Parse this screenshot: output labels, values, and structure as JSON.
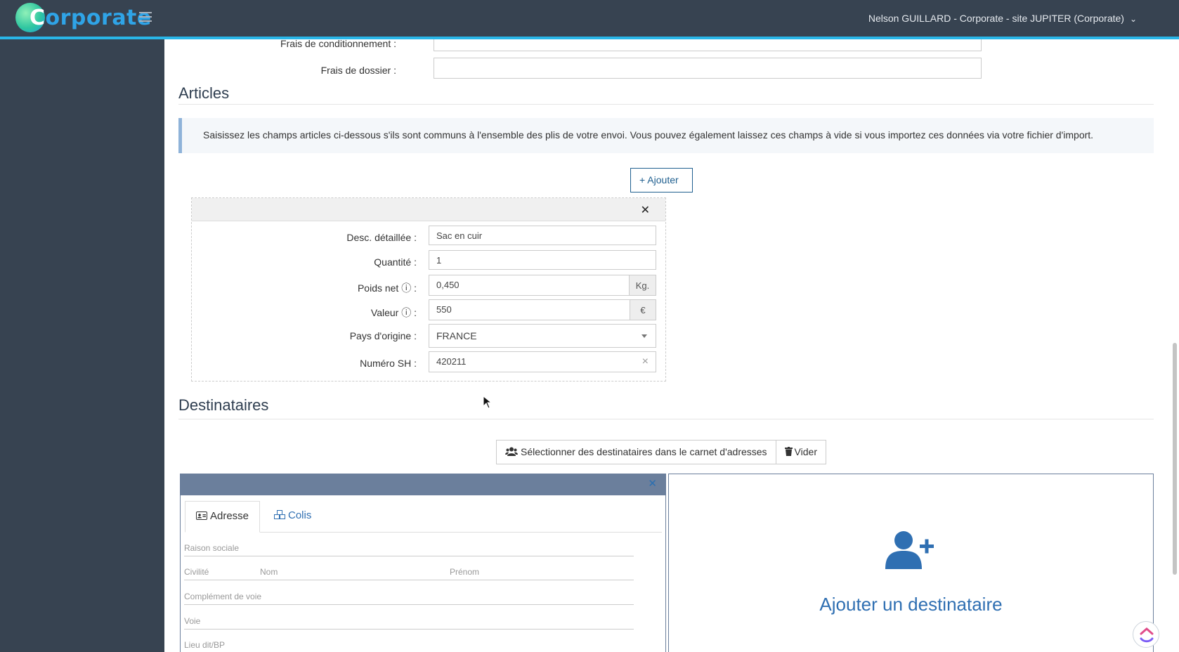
{
  "header": {
    "logo_letter": "C",
    "logo_text": "orporate",
    "user_label": "Nelson GUILLARD - Corporate - site JUPITER (Corporate)"
  },
  "fees": {
    "conditionnement_label": "Frais de conditionnement :",
    "conditionnement_value": "",
    "dossier_label": "Frais de dossier :",
    "dossier_value": ""
  },
  "articles": {
    "title": "Articles",
    "info": "Saisissez les champs articles ci-dessous s'ils sont communs à l'ensemble des plis de votre envoi. Vous pouvez également laissez ces champs à vide si vous importez ces données via votre fichier d'import.",
    "add_button": "+ Ajouter",
    "item": {
      "desc_label": "Desc. détaillée :",
      "desc_value": "Sac en cuir",
      "qty_label": "Quantité :",
      "qty_value": "1",
      "poids_label": "Poids net",
      "poids_value": "0,450",
      "poids_unit": "Kg.",
      "valeur_label": "Valeur",
      "valeur_value": "550",
      "valeur_unit": "€",
      "pays_label": "Pays d'origine :",
      "pays_value": "FRANCE",
      "sh_label": "Numéro SH :",
      "sh_value": "420211"
    }
  },
  "destinataires": {
    "title": "Destinataires",
    "select_button": "Sélectionner des destinataires dans le carnet d'adresses",
    "clear_button": "Vider",
    "tabs": [
      "Adresse",
      "Colis"
    ],
    "fields": {
      "raison_sociale": "Raison sociale",
      "civilite": "Civilité",
      "nom": "Nom",
      "prenom": "Prénom",
      "complement": "Complément de voie",
      "voie": "Voie",
      "lieu_dit": "Lieu dit/BP"
    },
    "add_label": "Ajouter un destinataire"
  },
  "colors": {
    "topbar": "#374351",
    "accent": "#29b6e8",
    "link": "#2f6fb2"
  }
}
